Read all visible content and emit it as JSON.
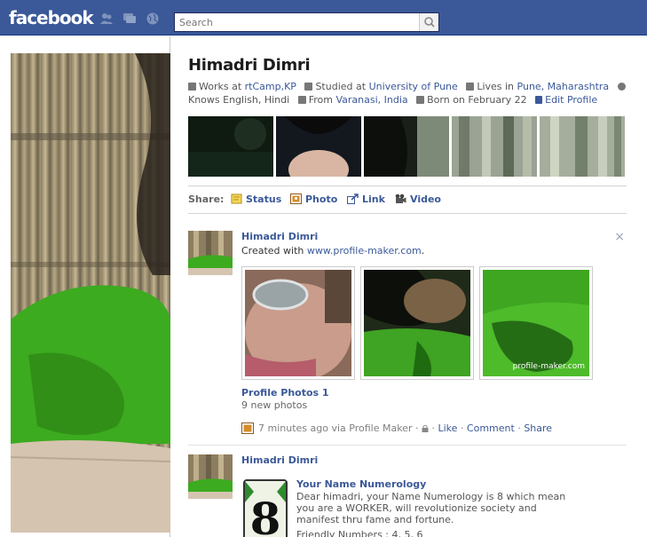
{
  "topbar": {
    "logo": "facebook",
    "search_placeholder": "Search"
  },
  "profile": {
    "name": "Himadri Dimri",
    "info": {
      "works_prefix": "Works at ",
      "works_link": "rtCamp,KP",
      "studied_prefix": "Studied at ",
      "studied_link": "University of Pune",
      "lives_prefix": "Lives in ",
      "lives_link": "Pune, Maharashtra",
      "knows": "Knows English, Hindi",
      "from_prefix": "From ",
      "from_link": "Varanasi, India",
      "born": "Born on February 22",
      "edit": "Edit Profile"
    }
  },
  "share": {
    "label": "Share:",
    "items": [
      "Status",
      "Photo",
      "Link",
      "Video"
    ]
  },
  "story1": {
    "author": "Himadri Dimri",
    "text_prefix": "Created with ",
    "text_link": "www.profile-maker.com",
    "text_suffix": ".",
    "close": "×",
    "watermark": "profile-maker.com",
    "album_title": "Profile Photos 1",
    "album_sub": "9 new photos",
    "meta": {
      "time": "7 minutes ago via Profile Maker",
      "sep": "·",
      "like": "Like",
      "comment": "Comment",
      "share": "Share"
    }
  },
  "story2": {
    "author": "Himadri Dimri",
    "app_title": "Your Name Numerology",
    "description": "Dear himadri, your Name Numerology is 8 which mean you are a WORKER, will revolutionize society and manifest thru fame and fortune.",
    "friendly": "Friendly Numbers : 4, 5, 6",
    "number": "8"
  },
  "colors": {
    "brand": "#3b5998",
    "link": "#3b5998"
  }
}
